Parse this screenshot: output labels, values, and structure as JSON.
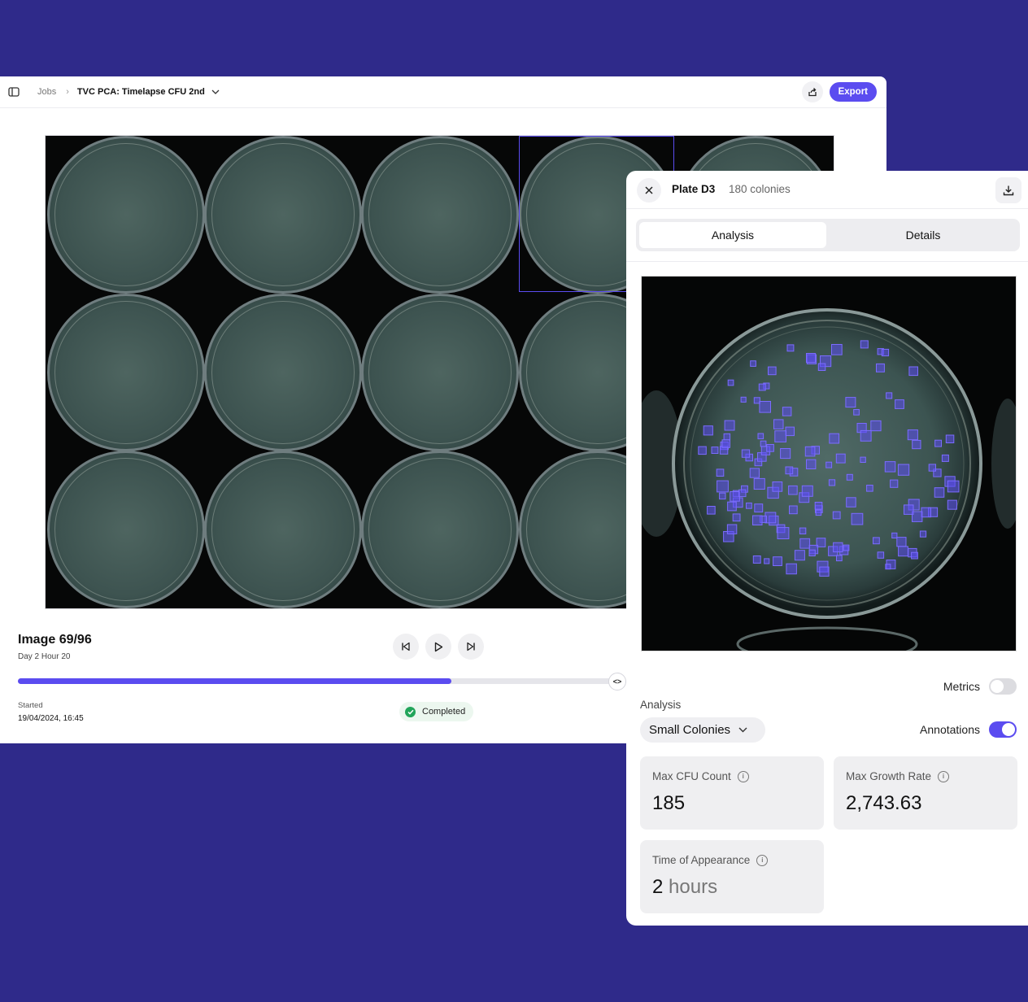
{
  "header": {
    "breadcrumb_root": "Jobs",
    "job_title": "TVC PCA: Timelapse CFU 2nd",
    "export_label": "Export"
  },
  "viewer": {
    "image_title": "Image 69/96",
    "image_subtitle": "Day 2 Hour 20",
    "progress_fraction": 0.72,
    "slider_knob": "<>",
    "started_label": "Started",
    "started_value": "19/04/2024, 16:45",
    "status": "Completed"
  },
  "panel": {
    "plate_name": "Plate D3",
    "colony_count": "180 colonies",
    "tabs": [
      {
        "label": "Analysis"
      },
      {
        "label": "Details"
      }
    ],
    "metrics_label": "Metrics",
    "metrics_on": false,
    "analysis_label": "Analysis",
    "analysis_selected": "Small Colonies",
    "annotations_label": "Annotations",
    "annotations_on": true,
    "cards": [
      {
        "label": "Max CFU Count",
        "value": "185",
        "unit": ""
      },
      {
        "label": "Max Growth Rate",
        "value": "2,743.63",
        "unit": ""
      },
      {
        "label": "Time of Appearance",
        "value": "2",
        "unit": "hours"
      }
    ]
  },
  "colors": {
    "background": "#2f2a8a",
    "accent": "#5b4cf0",
    "success": "#22a55a"
  },
  "icons": {
    "sidebar": "sidebar-toggle-icon",
    "share": "share-icon",
    "close": "close-icon",
    "download": "download-icon",
    "prev": "skip-back-icon",
    "play": "play-icon",
    "next": "skip-forward-icon"
  }
}
